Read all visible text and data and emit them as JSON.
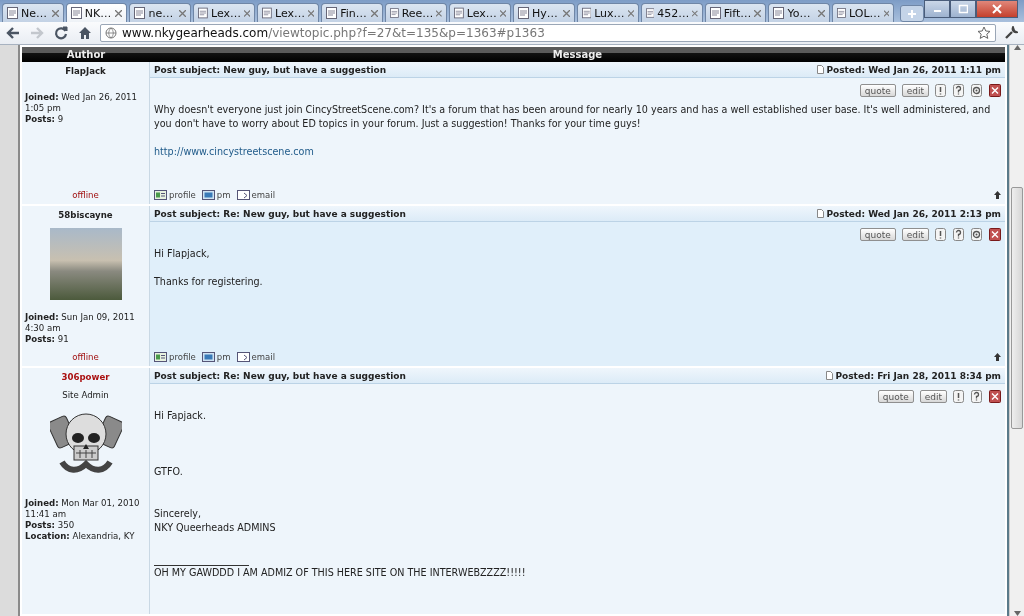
{
  "browser": {
    "tabs": [
      {
        "title": "Ne…",
        "selected": false
      },
      {
        "title": "NK…",
        "selected": true
      },
      {
        "title": "ne…",
        "selected": false
      },
      {
        "title": "Lex…",
        "selected": false
      },
      {
        "title": "Lex…",
        "selected": false
      },
      {
        "title": "Fin…",
        "selected": false
      },
      {
        "title": "Ree…",
        "selected": false
      },
      {
        "title": "Lex…",
        "selected": false
      },
      {
        "title": "Hy…",
        "selected": false
      },
      {
        "title": "Lux…",
        "selected": false
      },
      {
        "title": "452…",
        "selected": false
      },
      {
        "title": "Fift…",
        "selected": false
      },
      {
        "title": "Yo…",
        "selected": false
      },
      {
        "title": "LOL…",
        "selected": false
      }
    ],
    "nav": [
      {
        "kind": "back",
        "disabled": false
      },
      {
        "kind": "forward",
        "disabled": true
      },
      {
        "kind": "reload",
        "disabled": false
      },
      {
        "kind": "home",
        "disabled": false
      }
    ],
    "address": {
      "host": "www.nkygearheads.com",
      "path": "/viewtopic.php?f=27&t=135&p=1363#p1363"
    }
  },
  "forum": {
    "columns": [
      "Author",
      "Message"
    ],
    "posts": [
      {
        "author": {
          "name": "FlapJack",
          "color": "#222222"
        },
        "details": [
          {
            "label": "Joined:",
            "value": "Wed Jan 26, 2011 1:05 pm"
          },
          {
            "label": "Posts:",
            "value": "9"
          }
        ],
        "status": "offline",
        "subject": "Post subject: New guy, but have a suggestion",
        "posted": "Posted: Wed Jan 26, 2011 1:11 pm",
        "actions": [
          {
            "kind": "quote",
            "label": "quote"
          },
          {
            "kind": "edit",
            "label": "edit"
          },
          {
            "kind": "report"
          },
          {
            "kind": "info"
          },
          {
            "kind": "ip"
          },
          {
            "kind": "delete"
          }
        ],
        "body": [
          {
            "kind": "text",
            "text": "Why doesn't everyone just join CincyStreetScene.com? It's a forum that has been around for nearly 10 years and has a well established user base. It's well administered, and you don't have to worry about ED topics in your forum. Just a suggestion! Thanks for your time guys!"
          },
          {
            "kind": "link",
            "text": "http://www.cincystreetscene.com"
          }
        ],
        "footer": [
          {
            "kind": "profile",
            "label": "profile"
          },
          {
            "kind": "pm",
            "label": "pm"
          },
          {
            "kind": "email",
            "label": "email"
          }
        ],
        "top_link": true
      },
      {
        "author": {
          "name": "58biscayne",
          "color": "#222222",
          "avatar": {
            "kind": "photo"
          }
        },
        "details": [
          {
            "label": "Joined:",
            "value": "Sun Jan 09, 2011 4:30 am"
          },
          {
            "label": "Posts:",
            "value": "91"
          }
        ],
        "status": "offline",
        "subject": "Post subject: Re: New guy, but have a suggestion",
        "posted": "Posted: Wed Jan 26, 2011 2:13 pm",
        "actions": [
          {
            "kind": "quote",
            "label": "quote"
          },
          {
            "kind": "edit",
            "label": "edit"
          },
          {
            "kind": "report"
          },
          {
            "kind": "info"
          },
          {
            "kind": "ip"
          },
          {
            "kind": "delete"
          }
        ],
        "body": [
          {
            "kind": "text",
            "text": "Hi Flapjack,\n\nThanks for registering."
          }
        ],
        "footer": [
          {
            "kind": "profile",
            "label": "profile"
          },
          {
            "kind": "pm",
            "label": "pm"
          },
          {
            "kind": "email",
            "label": "email"
          }
        ],
        "top_link": true
      },
      {
        "author": {
          "name": "306power",
          "color": "#aa1111",
          "rank": "Site Admin",
          "avatar": {
            "kind": "skull"
          }
        },
        "details": [
          {
            "label": "Joined:",
            "value": "Mon Mar 01, 2010 11:41 am"
          },
          {
            "label": "Posts:",
            "value": "350"
          },
          {
            "label": "Location:",
            "value": "Alexandria, KY"
          }
        ],
        "subject": "Post subject: Re: New guy, but have a suggestion",
        "posted": "Posted: Fri Jan 28, 2011 8:34 pm",
        "actions": [
          {
            "kind": "quote",
            "label": "quote"
          },
          {
            "kind": "edit",
            "label": "edit"
          },
          {
            "kind": "report"
          },
          {
            "kind": "info"
          },
          {
            "kind": "delete"
          }
        ],
        "body": [
          {
            "kind": "text",
            "text": "Hi Fapjack.\n\n\n\nGTFO.\n\n\nSincerely,\nNKY Queerheads ADMINS"
          },
          {
            "kind": "signature",
            "text": "OH MY GAWDDD I AM ADMIZ OF THIS HERE SITE ON THE INTERWEBZZZZ!!!!!"
          }
        ],
        "top_link": false
      }
    ]
  }
}
